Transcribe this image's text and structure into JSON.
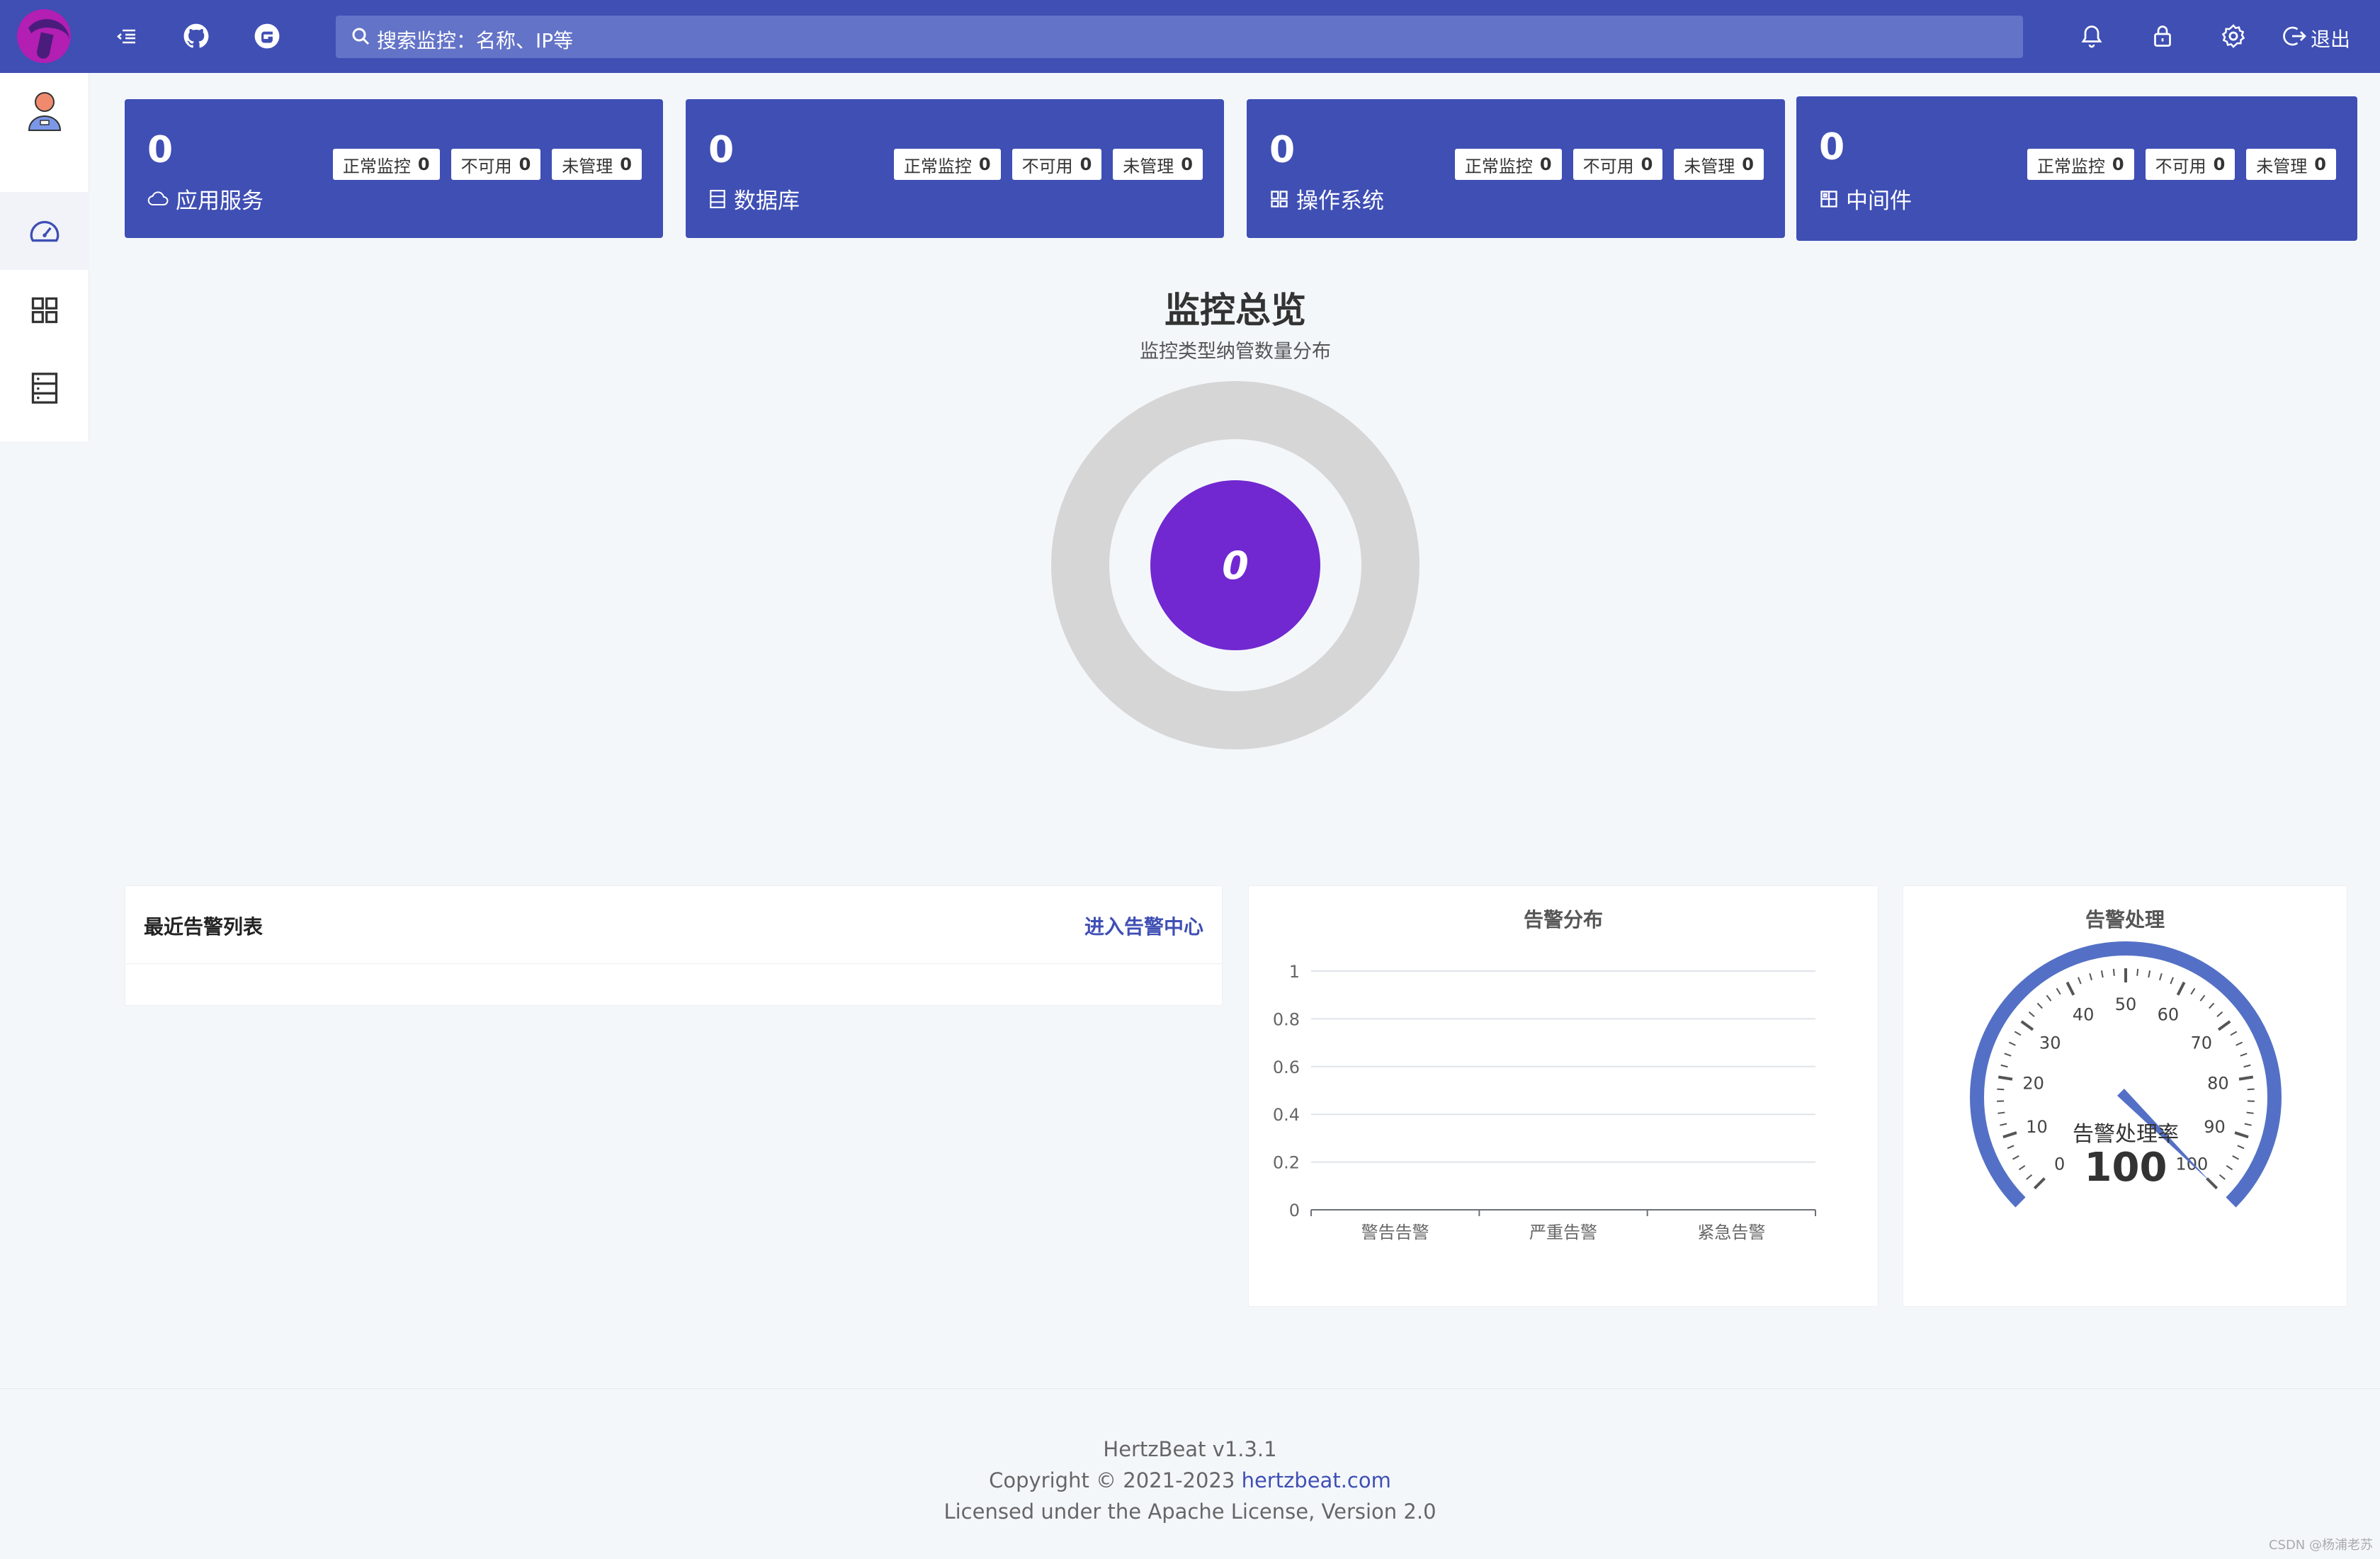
{
  "header": {
    "search_placeholder": "搜索监控：名称、IP等",
    "logout_label": "退出",
    "icons": [
      "menu-fold-icon",
      "github-icon",
      "gitee-icon",
      "bell-icon",
      "lock-icon",
      "gear-icon",
      "logout-icon"
    ]
  },
  "sidebar": {
    "items": [
      {
        "icon": "user-avatar-icon"
      },
      {
        "icon": "dashboard-icon",
        "active": true
      },
      {
        "icon": "appstore-icon"
      },
      {
        "icon": "database-icon"
      }
    ]
  },
  "cards": [
    {
      "count": "0",
      "label": "应用服务",
      "icon": "cloud-icon",
      "tags": [
        {
          "label": "正常监控",
          "value": "0"
        },
        {
          "label": "不可用",
          "value": "0"
        },
        {
          "label": "未管理",
          "value": "0"
        }
      ]
    },
    {
      "count": "0",
      "label": "数据库",
      "icon": "database-icon",
      "tags": [
        {
          "label": "正常监控",
          "value": "0"
        },
        {
          "label": "不可用",
          "value": "0"
        },
        {
          "label": "未管理",
          "value": "0"
        }
      ]
    },
    {
      "count": "0",
      "label": "操作系统",
      "icon": "windows-icon",
      "tags": [
        {
          "label": "正常监控",
          "value": "0"
        },
        {
          "label": "不可用",
          "value": "0"
        },
        {
          "label": "未管理",
          "value": "0"
        }
      ]
    },
    {
      "count": "0",
      "label": "中间件",
      "icon": "block-icon",
      "tags": [
        {
          "label": "正常监控",
          "value": "0"
        },
        {
          "label": "不可用",
          "value": "0"
        },
        {
          "label": "未管理",
          "value": "0"
        }
      ]
    }
  ],
  "overview": {
    "title": "监控总览",
    "subtitle": "监控类型纳管数量分布",
    "center_value": "0"
  },
  "alerts": {
    "title": "最近告警列表",
    "link": "进入告警中心"
  },
  "chart_data": [
    {
      "type": "bar",
      "title": "告警分布",
      "categories": [
        "警告告警",
        "严重告警",
        "紧急告警"
      ],
      "values": [
        0,
        0,
        0
      ],
      "ylim": [
        0,
        1
      ],
      "yticks": [
        "0",
        "0.2",
        "0.4",
        "0.6",
        "0.8",
        "1"
      ],
      "grid": true
    }
  ],
  "gauge": {
    "title": "告警处理",
    "label": "告警处理率",
    "value": 100,
    "display_value": "100",
    "min": 0,
    "max": 100,
    "ticks": [
      "0",
      "10",
      "20",
      "30",
      "40",
      "50",
      "60",
      "70",
      "80",
      "90",
      "100"
    ],
    "color": "#5470c6"
  },
  "footer": {
    "version": "HertzBeat v1.3.1",
    "copyright_prefix": "Copyright © 2021-2023 ",
    "copyright_link": "hertzbeat.com",
    "license": "Licensed under the Apache License, Version 2.0",
    "watermark": "CSDN @杨浦老苏"
  },
  "colors": {
    "primary": "#3f4fb4",
    "search_bg": "#6373c7",
    "center_dot": "#7128d0",
    "ring": "#d6d6d6"
  }
}
